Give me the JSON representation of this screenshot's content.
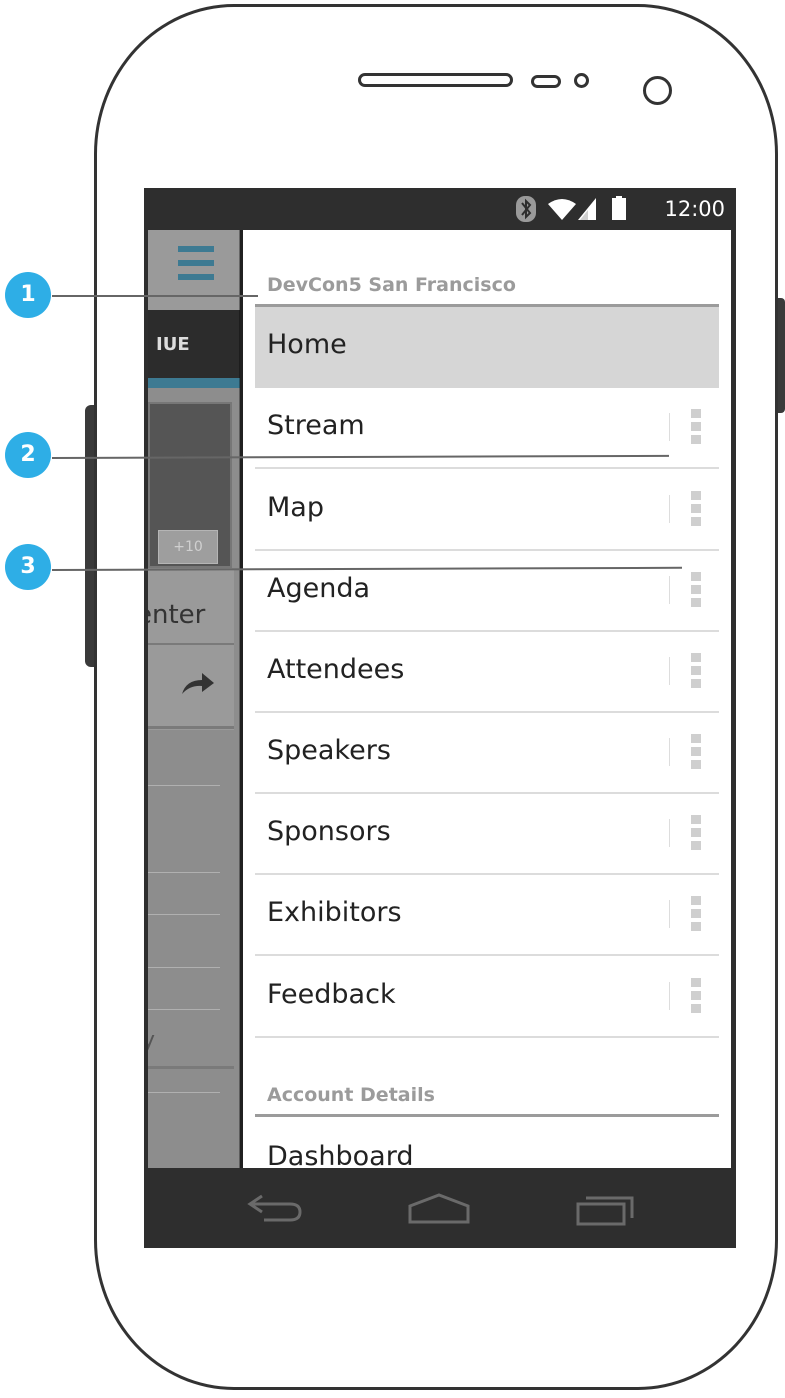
{
  "status_bar": {
    "time": "12:00",
    "icons": [
      "bluetooth-icon",
      "wifi-icon",
      "signal-icon",
      "battery-icon"
    ]
  },
  "background_app": {
    "tab_label_fragment": "IUE",
    "chip_label": "+10",
    "text_fragment": "enter",
    "bottom_fragment": "y"
  },
  "drawer": {
    "section_1": "DevCon5 San Francisco",
    "items": [
      {
        "label": "Home"
      },
      {
        "label": "Stream"
      },
      {
        "label": "Map"
      },
      {
        "label": "Agenda"
      },
      {
        "label": "Attendees"
      },
      {
        "label": "Speakers"
      },
      {
        "label": "Sponsors"
      },
      {
        "label": "Exhibitors"
      },
      {
        "label": "Feedback"
      }
    ],
    "section_2": "Account Details",
    "account_items": [
      {
        "label": "Dashboard"
      }
    ]
  },
  "callouts": [
    "1",
    "2",
    "3"
  ],
  "colors": {
    "accent": "#2eaee6",
    "teal": "#3d7a92",
    "active_row": "#d6d6d6"
  }
}
